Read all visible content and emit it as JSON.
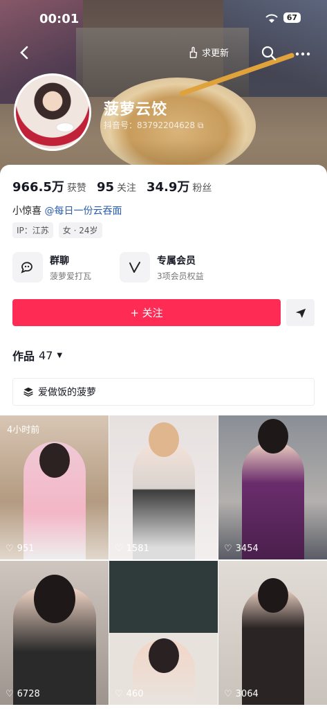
{
  "status_bar": {
    "time": "00:01",
    "battery": "67"
  },
  "topbar": {
    "update_label": "求更新"
  },
  "profile": {
    "nickname": "菠萝云饺",
    "douyin_id": "抖音号：83792204628",
    "stats": [
      {
        "num": "966.5万",
        "label": "获赞"
      },
      {
        "num": "95",
        "label": "关注"
      },
      {
        "num": "34.9万",
        "label": "粉丝"
      }
    ],
    "bio_prefix": "小惊喜 ",
    "bio_mention": "@每日一份云吞面",
    "tags": [
      "IP：江苏",
      "女 · 24岁"
    ]
  },
  "features": [
    {
      "title": "群聊",
      "sub": "菠萝爱打瓦",
      "icon": "chat-icon"
    },
    {
      "title": "专属会员",
      "sub": "3项会员权益",
      "icon": "vip-icon"
    }
  ],
  "follow_label": "+ 关注",
  "works": {
    "label": "作品",
    "count": "47"
  },
  "collection_label": "爱做饭的菠萝",
  "videos": [
    {
      "badge": "4小时前",
      "likes": "951"
    },
    {
      "badge": "",
      "likes": "1581"
    },
    {
      "badge": "",
      "likes": "3454"
    },
    {
      "badge": "",
      "likes": "6728"
    },
    {
      "badge": "",
      "likes": "460"
    },
    {
      "badge": "",
      "likes": "3064"
    }
  ],
  "colors": {
    "accent": "#fe2c55",
    "mention": "#2a5db0"
  }
}
